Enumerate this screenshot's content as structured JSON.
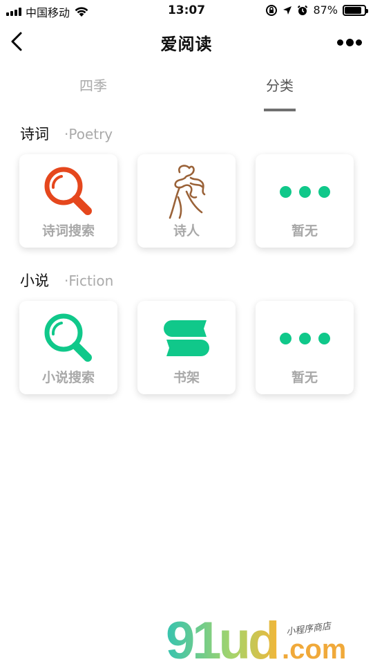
{
  "status_bar": {
    "carrier": "中国移动",
    "time": "13:07",
    "battery_percent": "87%",
    "battery_level": 0.87,
    "icons": [
      "signal-icon",
      "wifi-icon",
      "orientation-lock-icon",
      "location-icon",
      "alarm-icon",
      "battery-icon"
    ]
  },
  "nav": {
    "title": "爱阅读",
    "icons": [
      "back-icon",
      "more-icon"
    ]
  },
  "tabs": [
    {
      "label": "四季",
      "active": false
    },
    {
      "label": "分类",
      "active": true
    }
  ],
  "sections": [
    {
      "title": "诗词",
      "subtitle": "·Poetry",
      "cards": [
        {
          "label": "诗词搜索",
          "icon": "search-icon",
          "color": "#e5471d"
        },
        {
          "label": "诗人",
          "icon": "poet-icon",
          "color": "#9a6238"
        },
        {
          "label": "暂无",
          "icon": "more-dots-icon",
          "color": "#10c88a"
        }
      ]
    },
    {
      "title": "小说",
      "subtitle": "·Fiction",
      "cards": [
        {
          "label": "小说搜索",
          "icon": "search-icon",
          "color": "#10c88a"
        },
        {
          "label": "书架",
          "icon": "bookshelf-icon",
          "color": "#10c88a"
        },
        {
          "label": "暂无",
          "icon": "more-dots-icon",
          "color": "#10c88a"
        }
      ]
    }
  ],
  "watermark": {
    "logo": "91ud",
    "domain": ".com",
    "tagline": "小程序商店"
  }
}
